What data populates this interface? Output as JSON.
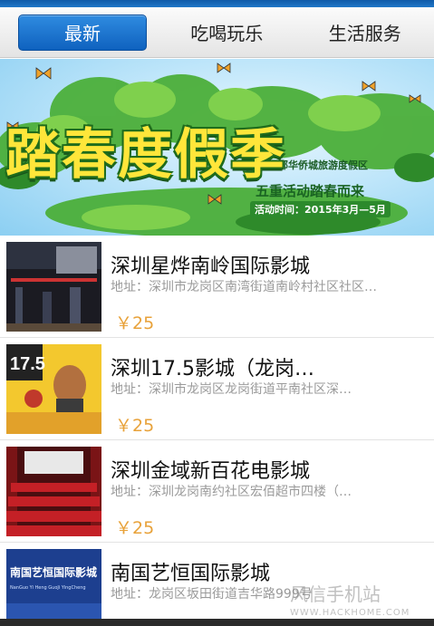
{
  "tabs": [
    {
      "label": "最新",
      "active": true
    },
    {
      "label": "吃喝玩乐",
      "active": false
    },
    {
      "label": "生活服务",
      "active": false
    }
  ],
  "banner": {
    "subtitle": "东部华侨城旅游度假区",
    "title": "踏春度假季",
    "slogan": "五重活动踏春而来",
    "date": "活动时间：2015年3月—5月"
  },
  "items": [
    {
      "title": "深圳星烨南岭国际影城",
      "address": "地址：深圳市龙岗区南湾街道南岭村社区社区…",
      "price": "￥25"
    },
    {
      "title": "深圳17.5影城（龙岗…",
      "address": "地址：深圳市龙岗区龙岗街道平南社区深…",
      "price": "￥25"
    },
    {
      "title": "深圳金域新百花电影城",
      "address": "地址：深圳龙岗南约社区宏佰超市四楼（…",
      "price": "￥25"
    },
    {
      "title": "南国艺恒国际影城",
      "address": "地址：龙岗区坂田街道吉华路999号",
      "price": ""
    }
  ],
  "thumb_text": {
    "item2": "17.5",
    "item4_line1": "南国艺恒国际影城",
    "item4_line2": "NanGuo Yi Heng GuoJi YingCheng"
  },
  "watermark": {
    "line1": "风信手机站",
    "line2": "WWW.HACKHOME.COM"
  },
  "colors": {
    "accent": "#1a6fcb",
    "price": "#e8a23a",
    "banner_title": "#ffe63a"
  }
}
